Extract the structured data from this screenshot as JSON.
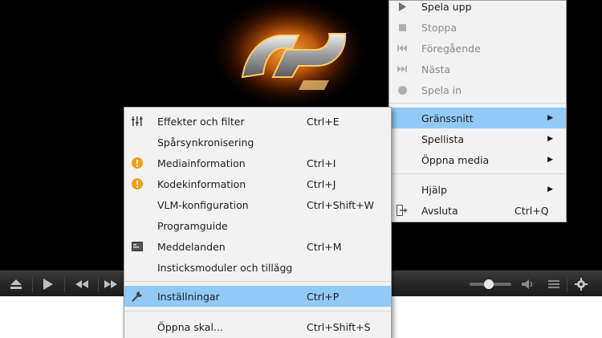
{
  "main_menu": {
    "items": [
      {
        "label": "Spela upp",
        "icon": "play-icon",
        "enabled": true
      },
      {
        "label": "Stoppa",
        "icon": "stop-icon",
        "enabled": false
      },
      {
        "label": "Föregående",
        "icon": "previous-icon",
        "enabled": false
      },
      {
        "label": "Nästa",
        "icon": "next-icon",
        "enabled": false
      },
      {
        "label": "Spela in",
        "icon": "record-icon",
        "enabled": false
      },
      {
        "label": "Gränssnitt",
        "has_submenu": true,
        "highlighted": true
      },
      {
        "label": "Spellista",
        "has_submenu": true
      },
      {
        "label": "Öppna media",
        "has_submenu": true
      },
      {
        "label": "Hjälp",
        "has_submenu": true
      },
      {
        "label": "Avsluta",
        "shortcut": "Ctrl+Q",
        "icon": "exit-icon"
      }
    ]
  },
  "submenu": {
    "items": [
      {
        "label": "Effekter och filter",
        "shortcut": "Ctrl+E",
        "icon": "equalizer-icon"
      },
      {
        "label": "Spårsynkronisering",
        "shortcut": ""
      },
      {
        "label": "Mediainformation",
        "shortcut": "Ctrl+I",
        "icon": "info-icon"
      },
      {
        "label": "Kodekinformation",
        "shortcut": "Ctrl+J",
        "icon": "info-icon"
      },
      {
        "label": "VLM-konfiguration",
        "shortcut": "Ctrl+Shift+W"
      },
      {
        "label": "Programguide",
        "shortcut": ""
      },
      {
        "label": "Meddelanden",
        "shortcut": "Ctrl+M",
        "icon": "messages-icon"
      },
      {
        "label": "Insticksmoduler och tillägg",
        "shortcut": ""
      },
      {
        "label": "Inställningar",
        "shortcut": "Ctrl+P",
        "icon": "wrench-icon",
        "highlighted": true
      },
      {
        "label": "Öppna skal...",
        "shortcut": "Ctrl+Shift+S"
      }
    ]
  },
  "controls": {
    "buttons": [
      "eject-icon",
      "play-icon",
      "rewind-icon",
      "fast-forward-icon",
      "volume-icon",
      "playlist-icon",
      "settings-gear-icon"
    ],
    "volume_level": 0.45
  },
  "colors": {
    "highlight": "#91c9f7",
    "menu_bg": "#f2f2f2",
    "info_orange": "#f0a020",
    "logo_glow": "#ff8c1a"
  }
}
